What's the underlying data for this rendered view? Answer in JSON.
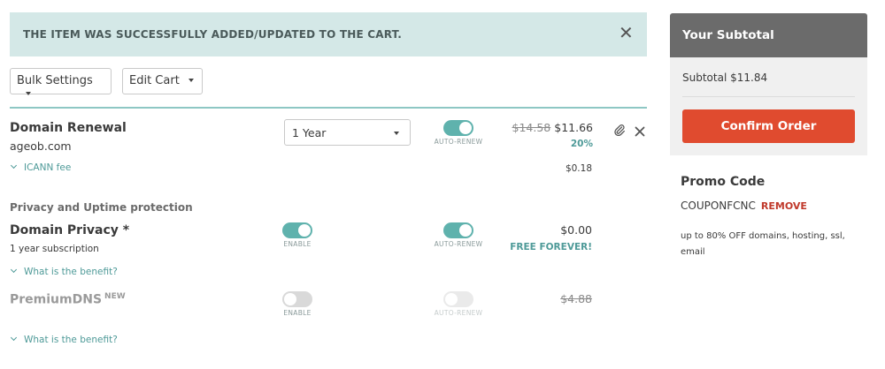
{
  "notice": {
    "message": "THE ITEM WAS SUCCESSFULLY ADDED/UPDATED TO THE CART.",
    "close": "✕"
  },
  "toolbar": {
    "bulk_settings": "Bulk Settings",
    "edit_cart": "Edit Cart"
  },
  "renewal": {
    "title": "Domain Renewal",
    "domain": "ageob.com",
    "period": "1 Year",
    "auto_renew_label": "AUTO-RENEW",
    "auto_renew": true,
    "old_price": "$14.58",
    "price": "$11.66",
    "discount": "20%",
    "icann_link": "ICANN fee",
    "icann_fee": "$0.18"
  },
  "privacy_section": {
    "heading": "Privacy and Uptime protection"
  },
  "privacy": {
    "title": "Domain Privacy *",
    "subtitle": "1 year subscription",
    "enable_label": "ENABLE",
    "enabled": true,
    "auto_renew_label": "AUTO-RENEW",
    "auto_renew": true,
    "price": "$0.00",
    "free_note": "FREE FOREVER!",
    "benefit_link": "What is the benefit?"
  },
  "premium_dns": {
    "title": "PremiumDNS",
    "badge": "NEW",
    "enable_label": "ENABLE",
    "enabled": false,
    "auto_renew_label": "AUTO-RENEW",
    "auto_renew": false,
    "price": "$4.88",
    "benefit_link": "What is the benefit?"
  },
  "subtotal": {
    "heading": "Your Subtotal",
    "line": "Subtotal $11.84",
    "confirm": "Confirm Order"
  },
  "promo": {
    "heading": "Promo Code",
    "code": "COUPONFCNC",
    "remove": "REMOVE",
    "description": "up to 80% OFF domains, hosting, ssl, email"
  },
  "colors": {
    "accent_teal": "#5fb2ad",
    "confirm_red": "#e04b2f",
    "notice_bg": "#d4e8e7"
  }
}
